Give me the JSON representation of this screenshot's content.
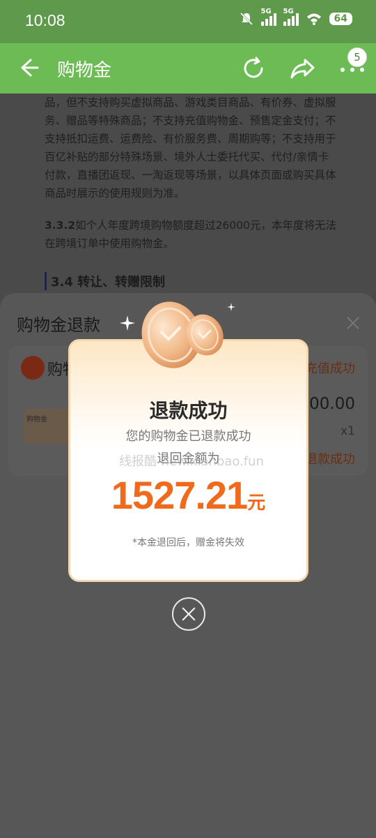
{
  "status_bar": {
    "time": "10:08",
    "sim1": "5G",
    "sim2": "5G",
    "battery": "64"
  },
  "app_bar": {
    "title": "购物金",
    "badge": "5"
  },
  "article": {
    "paragraph1": "品，但不支持购买虚拟商品、游戏类目商品、有价券、虚拟服务、赠品等特殊商品；不支持充值购物金、预售定金支付；不支持抵扣运费、运费险、有价服务费、周期购等；不支持用于百亿补贴的部分特殊场景、境外人士委托代买、代付/亲情卡付款，直播团返现、一淘返现等场景，以具体页面或购买具体商品时展示的使用规则为准。",
    "paragraph2_num": "3.3.2",
    "paragraph2": "如个人年度跨境购物额度超过26000元，本年度将无法在跨境订单中使用购物金。",
    "heading": "3.4 转让、转赠限制"
  },
  "sheet": {
    "title": "购物金退款",
    "shop_name_partial": "购物",
    "order_status": "充值成功",
    "thumb_label": "购物金",
    "price_partial": "300.00",
    "quantity": "x1",
    "refund_status": "退款成功"
  },
  "popup": {
    "title": "退款成功",
    "subtitle": "您的购物金已退款成功",
    "amount_label": "退回金额为",
    "watermark": "线报酷-new.xianbao.fun",
    "amount": "1527.21",
    "unit": "元",
    "note": "*本金退回后，赠金将失效"
  },
  "colors": {
    "accent": "#f06a1c",
    "appbar": "#6cbb55",
    "statusbar": "#5f9a4c"
  }
}
